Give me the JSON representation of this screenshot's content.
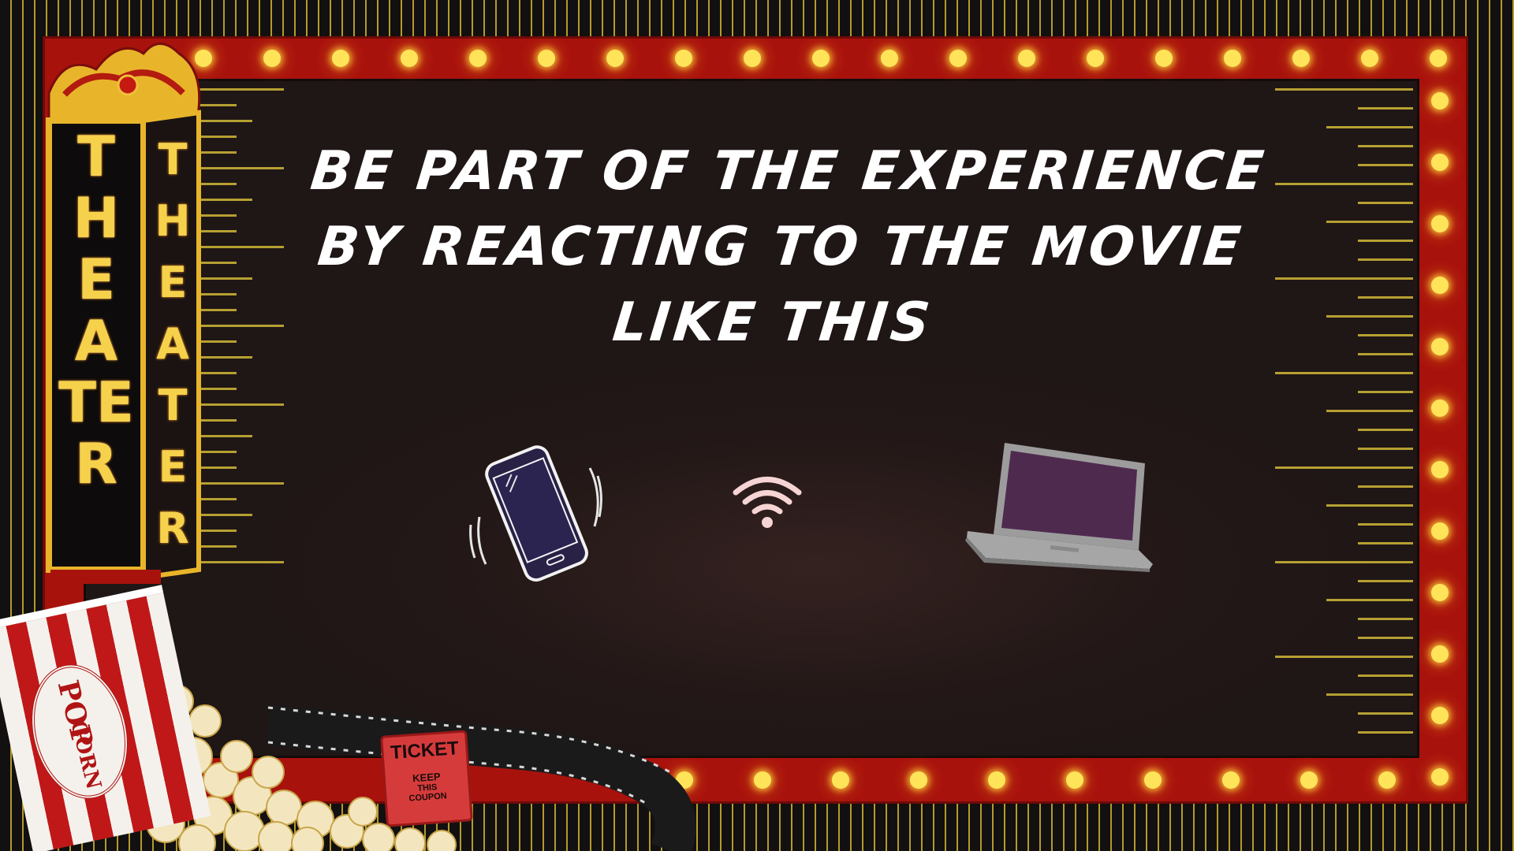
{
  "heading": {
    "line1": "Be part of the experience",
    "line2": "by reacting to the movie",
    "line3": "like this"
  },
  "marquee_sign": {
    "text_left": "THEATER",
    "text_right": "THEATER"
  },
  "popcorn_box": {
    "label_line1": "POP",
    "label_line2": "CORN"
  },
  "ticket": {
    "title": "TICKET",
    "line1": "KEEP",
    "line2": "THIS",
    "line3": "COUPON"
  },
  "icons": [
    "smartphone-icon",
    "wifi-icon",
    "laptop-icon"
  ],
  "colors": {
    "frame_red": "#a8120d",
    "bulb_yellow": "#ffe45a",
    "screen_dark": "#1f1616",
    "phone_screen": "#2a2147",
    "laptop_screen": "#4f2a4f",
    "wifi_pink": "#f7d4d4",
    "sign_gold": "#e8b52a"
  }
}
